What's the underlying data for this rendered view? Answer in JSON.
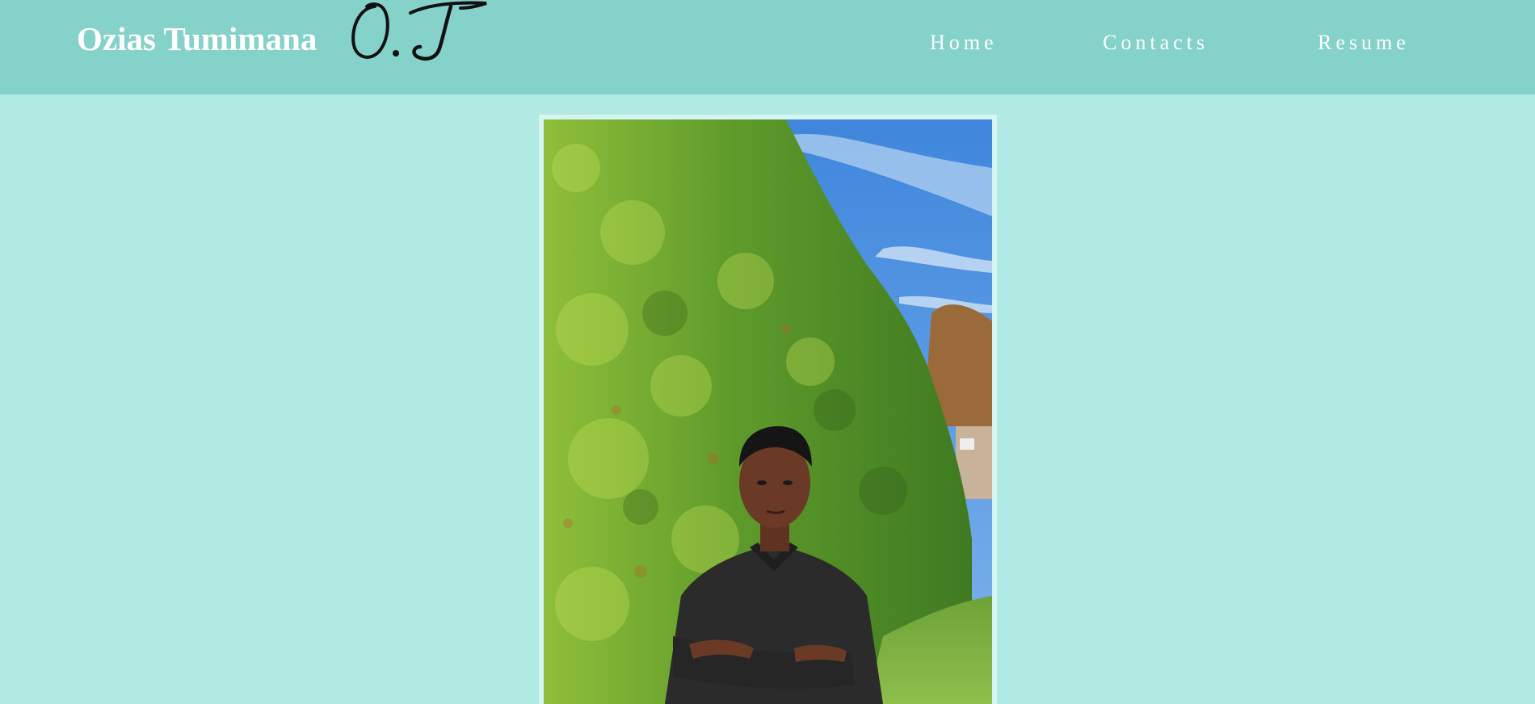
{
  "header": {
    "site_name": "Ozias Tumimana",
    "logo_text": "O.T",
    "nav": [
      {
        "label": "Home"
      },
      {
        "label": "Contacts"
      },
      {
        "label": "Resume"
      }
    ]
  },
  "colors": {
    "header_bg": "#85d2ca",
    "page_bg": "#b1e9e3",
    "text": "#ffffff"
  },
  "main": {
    "photo": {
      "subject": "portrait-photo"
    }
  }
}
